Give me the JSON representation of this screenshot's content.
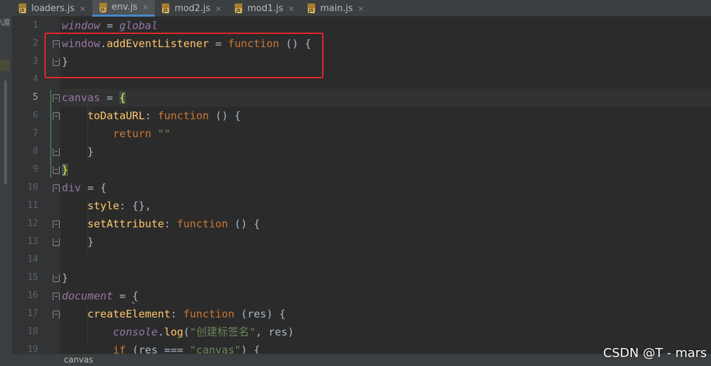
{
  "left_panel": {
    "glyph": "\\渡"
  },
  "tabs": [
    {
      "label": "loaders.js",
      "icon": "js-file-icon",
      "active": false
    },
    {
      "label": "env.js",
      "icon": "js-file-icon",
      "active": true
    },
    {
      "label": "mod2.js",
      "icon": "js-file-icon",
      "active": false
    },
    {
      "label": "mod1.js",
      "icon": "js-file-icon",
      "active": false
    },
    {
      "label": "main.js",
      "icon": "js-file-icon",
      "active": false
    }
  ],
  "tab_icon_text": "JS",
  "tab_close_glyph": "×",
  "current_line": 5,
  "code_lines": [
    {
      "n": 1,
      "tokens": [
        [
          "glob",
          "window"
        ],
        [
          "plain",
          " = "
        ],
        [
          "glob",
          "global"
        ]
      ]
    },
    {
      "n": 2,
      "tokens": [
        [
          "gvar",
          "window"
        ],
        [
          "plain",
          "."
        ],
        [
          "prop",
          "addEventListener"
        ],
        [
          "plain",
          " = "
        ],
        [
          "kw",
          "function"
        ],
        [
          "plain",
          " () {"
        ]
      ]
    },
    {
      "n": 3,
      "tokens": [
        [
          "plain",
          "}"
        ]
      ]
    },
    {
      "n": 4,
      "tokens": []
    },
    {
      "n": 5,
      "tokens": [
        [
          "gvar",
          "canvas"
        ],
        [
          "plain",
          " = "
        ],
        [
          "brace-hl",
          "{"
        ]
      ]
    },
    {
      "n": 6,
      "tokens": [
        [
          "plain",
          "    "
        ],
        [
          "prop",
          "toDataURL"
        ],
        [
          "plain",
          ": "
        ],
        [
          "kw",
          "function"
        ],
        [
          "plain",
          " () {"
        ]
      ]
    },
    {
      "n": 7,
      "tokens": [
        [
          "plain",
          "        "
        ],
        [
          "kw",
          "return"
        ],
        [
          "plain",
          " "
        ],
        [
          "str",
          "\"\""
        ]
      ]
    },
    {
      "n": 8,
      "tokens": [
        [
          "plain",
          "    }"
        ]
      ]
    },
    {
      "n": 9,
      "tokens": [
        [
          "brace-hl",
          "}"
        ]
      ]
    },
    {
      "n": 10,
      "tokens": [
        [
          "gvar",
          "div"
        ],
        [
          "plain",
          " = {"
        ]
      ]
    },
    {
      "n": 11,
      "tokens": [
        [
          "plain",
          "    "
        ],
        [
          "prop",
          "style"
        ],
        [
          "plain",
          ": {},"
        ]
      ]
    },
    {
      "n": 12,
      "tokens": [
        [
          "plain",
          "    "
        ],
        [
          "prop",
          "setAttribute"
        ],
        [
          "plain",
          ": "
        ],
        [
          "kw",
          "function"
        ],
        [
          "plain",
          " () {"
        ]
      ]
    },
    {
      "n": 13,
      "tokens": [
        [
          "plain",
          "    }"
        ]
      ]
    },
    {
      "n": 14,
      "tokens": []
    },
    {
      "n": 15,
      "tokens": [
        [
          "plain",
          "}"
        ]
      ]
    },
    {
      "n": 16,
      "tokens": [
        [
          "glob",
          "document"
        ],
        [
          "plain",
          " = "
        ],
        [
          "squig",
          "{"
        ]
      ]
    },
    {
      "n": 17,
      "tokens": [
        [
          "plain",
          "    "
        ],
        [
          "prop",
          "createElement"
        ],
        [
          "plain",
          ": "
        ],
        [
          "kw",
          "function"
        ],
        [
          "plain",
          " (res) {"
        ]
      ]
    },
    {
      "n": 18,
      "tokens": [
        [
          "plain",
          "        "
        ],
        [
          "glob",
          "console"
        ],
        [
          "plain",
          "."
        ],
        [
          "prop",
          "log"
        ],
        [
          "plain",
          "("
        ],
        [
          "str",
          "\"创建标签名\""
        ],
        [
          "plain",
          ", res)"
        ]
      ]
    },
    {
      "n": 19,
      "tokens": [
        [
          "plain",
          "        "
        ],
        [
          "kw",
          "if"
        ],
        [
          "plain",
          " (res === "
        ],
        [
          "str",
          "\"canvas\""
        ],
        [
          "plain",
          ") {"
        ]
      ]
    }
  ],
  "breadcrumb": "canvas",
  "watermark": "CSDN @T - mars",
  "colors": {
    "keyword": "#cc7832",
    "property": "#ffc66d",
    "global": "#9876aa",
    "string": "#6a8759",
    "annotation": "#e0282b",
    "active_tab_underline": "#4a88c7"
  }
}
